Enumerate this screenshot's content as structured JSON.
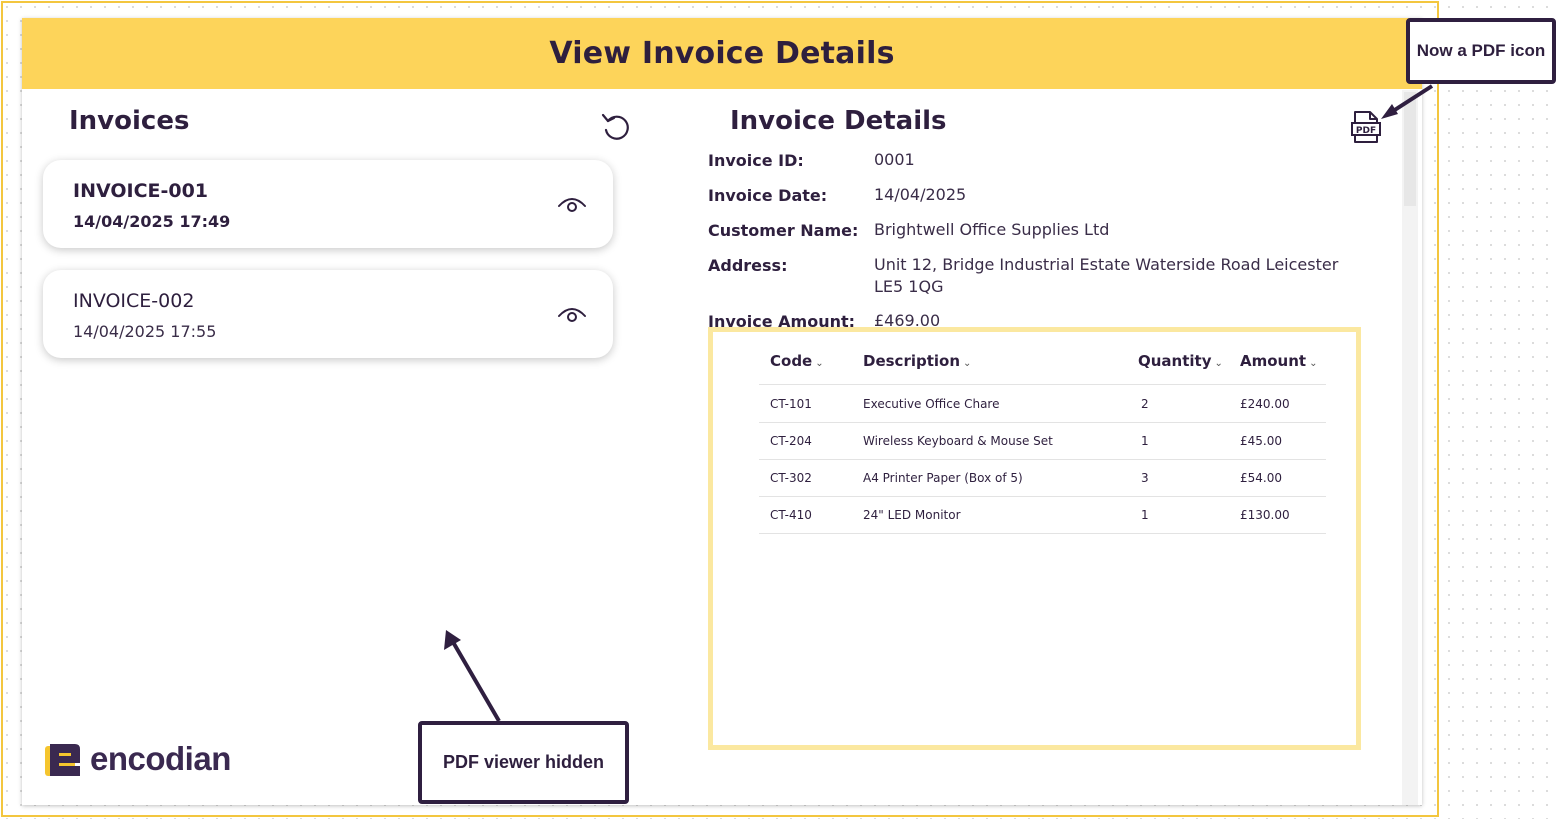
{
  "header": {
    "title": "View Invoice Details"
  },
  "invoices_panel": {
    "title": "Invoices",
    "items": [
      {
        "id": "INVOICE-001",
        "datetime": "14/04/2025 17:49",
        "selected": true
      },
      {
        "id": "INVOICE-002",
        "datetime": "14/04/2025 17:55",
        "selected": false
      }
    ]
  },
  "details": {
    "title": "Invoice Details",
    "fields": [
      {
        "label": "Invoice ID:",
        "value": "0001"
      },
      {
        "label": "Invoice Date:",
        "value": "14/04/2025"
      },
      {
        "label": "Customer Name:",
        "value": "Brightwell Office Supplies Ltd"
      },
      {
        "label": "Address:",
        "value": "Unit 12, Bridge Industrial Estate Waterside Road Leicester LE5 1QG"
      },
      {
        "label": "Invoice Amount:",
        "value": "£469.00"
      }
    ]
  },
  "line_items": {
    "columns": [
      "Code",
      "Description",
      "Quantity",
      "Amount"
    ],
    "rows": [
      [
        "CT-101",
        "Executive Office Chare",
        "2",
        "£240.00"
      ],
      [
        "CT-204",
        "Wireless Keyboard & Mouse Set",
        "1",
        "£45.00"
      ],
      [
        "CT-302",
        "A4 Printer Paper (Box of 5)",
        "3",
        "£54.00"
      ],
      [
        "CT-410",
        "24\" LED Monitor",
        "1",
        "£130.00"
      ]
    ]
  },
  "logo": {
    "text": "encodian"
  },
  "annotations": {
    "pdf_icon_note": "Now a PDF icon",
    "pdf_viewer_note": "PDF viewer hidden"
  },
  "icons": {
    "refresh": "refresh-icon",
    "view": "eye-icon",
    "pdf": "pdf-file-icon",
    "chevron": "chevron-down-icon"
  },
  "colors": {
    "header_bg": "#fdd45a",
    "frame": "#f3c63f",
    "table_frame": "#fbe8a0",
    "text_dark": "#2e1f3e",
    "logo_accent": "#f5c52e"
  }
}
